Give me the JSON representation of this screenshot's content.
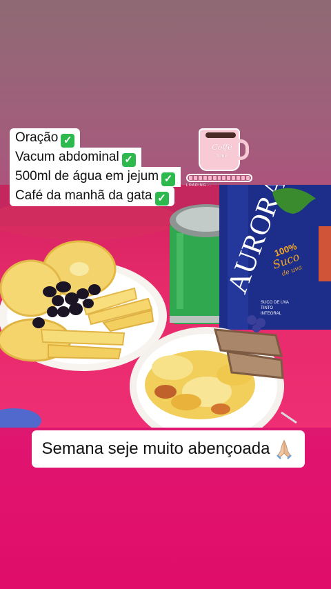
{
  "checklist": {
    "items": [
      {
        "label": "Oração",
        "check_icon": "green-check-icon"
      },
      {
        "label": "Vacum abdominal",
        "check_icon": "green-check-icon"
      },
      {
        "label": "500ml de água em jejum",
        "check_icon": "green-check-icon"
      },
      {
        "label": "Café da manhã da gata",
        "check_icon": "green-check-icon"
      }
    ],
    "check_glyph": "✓",
    "check_color": "#2db94d"
  },
  "coffee_sticker": {
    "cup_text_line1": "Coffe",
    "cup_text_line2": "time",
    "loading_text": "LOADING...",
    "icon": "coffee-cup-icon"
  },
  "photo": {
    "bottle_brand": "AURORA",
    "bottle_badge_line1": "100%",
    "bottle_badge_line2": "Suco",
    "bottle_badge_line3": "de uva",
    "bottle_small_text_1": "SUCO DE UVA",
    "bottle_small_text_2": "TINTO",
    "bottle_small_text_3": "INTEGRAL"
  },
  "caption": {
    "text": "Semana seje muito abençoada",
    "emoji_icon": "praying-hands-icon"
  },
  "colors": {
    "background_top": "#8e6a74",
    "background_bottom": "#e00d6a",
    "tablecloth": "#e52a6a",
    "tumbler_green": "#2fa84f",
    "bottle_blue": "#1d2e8a"
  }
}
